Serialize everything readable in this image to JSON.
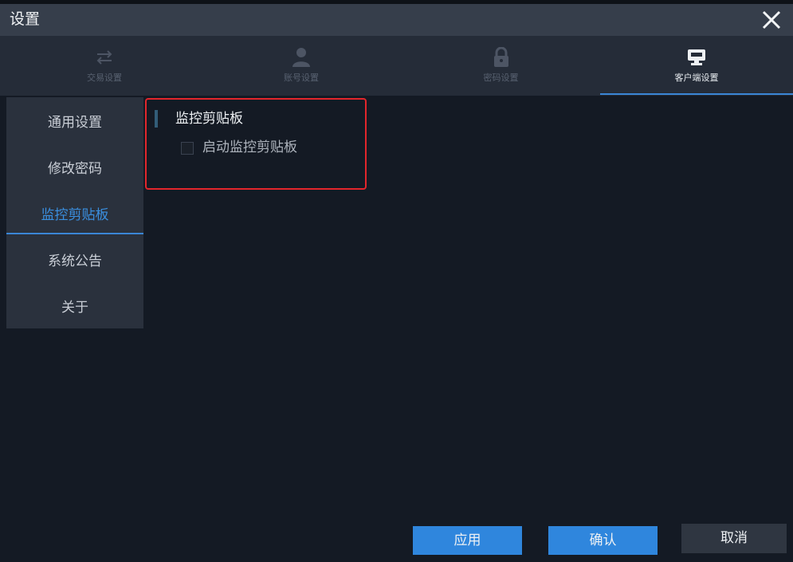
{
  "window": {
    "title": "设置"
  },
  "tabs": [
    {
      "label": "交易设置",
      "icon": "swap-arrows-icon",
      "active": false
    },
    {
      "label": "账号设置",
      "icon": "user-icon",
      "active": false
    },
    {
      "label": "密码设置",
      "icon": "lock-icon",
      "active": false
    },
    {
      "label": "客户端设置",
      "icon": "monitor-icon",
      "active": true
    }
  ],
  "sidebar": {
    "items": [
      {
        "label": "通用设置",
        "active": false
      },
      {
        "label": "修改密码",
        "active": false
      },
      {
        "label": "监控剪贴板",
        "active": true
      },
      {
        "label": "系统公告",
        "active": false
      },
      {
        "label": "关于",
        "active": false
      }
    ]
  },
  "section": {
    "title": "监控剪贴板",
    "checkbox_label": "启动监控剪贴板",
    "checkbox_checked": false
  },
  "buttons": {
    "apply": "应用",
    "confirm": "确认",
    "cancel": "取消"
  },
  "colors": {
    "accent": "#2f86dd",
    "highlight": "#e3262c",
    "background": "#141a24"
  }
}
